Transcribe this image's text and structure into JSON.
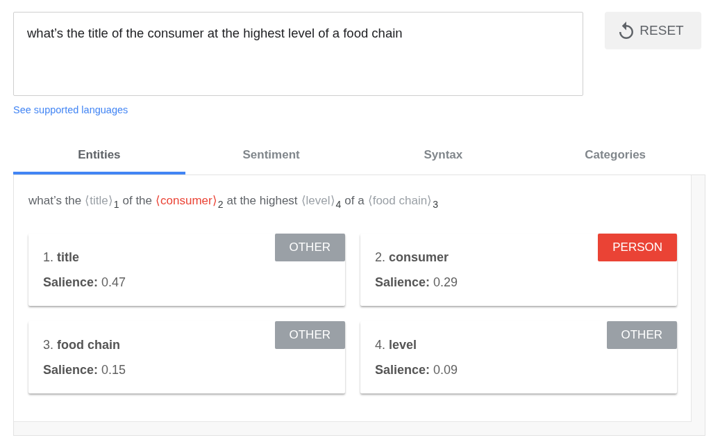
{
  "query": {
    "value": "what’s the title of the consumer at the highest level of a food chain"
  },
  "reset_button": {
    "label": "RESET"
  },
  "languages_link": "See supported languages",
  "tabs": [
    {
      "label": "Entities",
      "selected": true
    },
    {
      "label": "Sentiment",
      "selected": false
    },
    {
      "label": "Syntax",
      "selected": false
    },
    {
      "label": "Categories",
      "selected": false
    }
  ],
  "annotated_text": [
    {
      "kind": "text",
      "text": "what’s the"
    },
    {
      "kind": "entity",
      "text": "⟨title⟩",
      "index": "1",
      "color": "#9aa0a6"
    },
    {
      "kind": "text",
      "text": "of the"
    },
    {
      "kind": "entity",
      "text": "⟨consumer⟩",
      "index": "2",
      "color": "#ea4335"
    },
    {
      "kind": "text",
      "text": "at the highest"
    },
    {
      "kind": "entity",
      "text": "⟨level⟩",
      "index": "4",
      "color": "#9aa0a6"
    },
    {
      "kind": "text",
      "text": "of a"
    },
    {
      "kind": "entity",
      "text": "⟨food chain⟩",
      "index": "3",
      "color": "#9aa0a6"
    }
  ],
  "entities": [
    {
      "title": "1. **title**",
      "salience": "**Salience:** 0.47",
      "type": "OTHER",
      "color": "#9aa0a6"
    },
    {
      "title": "2. **consumer**",
      "salience": "**Salience:** 0.29",
      "type": "PERSON",
      "color": "#ea4335"
    },
    {
      "title": "3. **food chain**",
      "salience": "**Salience:** 0.15",
      "type": "OTHER",
      "color": "#9aa0a6"
    },
    {
      "title": "4. **level**",
      "salience": "**Salience:** 0.09",
      "type": "OTHER",
      "color": "#9aa0a6"
    }
  ]
}
